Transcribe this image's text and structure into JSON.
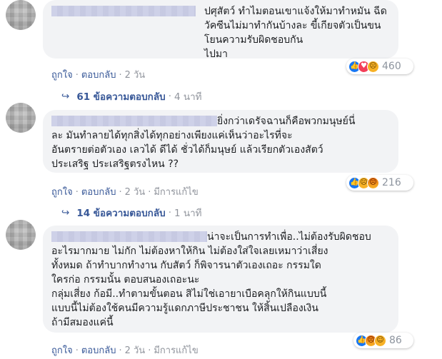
{
  "comments": [
    {
      "text": "ปศุสัตว์ ทำไมตอนเขาแจ้งให้มาทำหมัน ฉีด\nวัคซีนไม่มาทำกันบ้างละ ขี้เกียจตัวเป็นขน โยนความรับผิดชอบกัน\nไปมา",
      "reaction_count": "460",
      "reactions": [
        "like-icon",
        "love-icon",
        "sad-icon"
      ],
      "actions": {
        "like": "ถูกใจ",
        "reply": "ตอบกลับ",
        "time": "2 วัน"
      }
    },
    {
      "text": "ยิ่งกว่าเดรัจฉานก็คือพวกมนุษย์นี่\nละ มันทำลายได้ทุกสิ่งได้ทุกอย่างเพียงแค่เห็นว่าอะไรที่จะ\nอันตรายต่อตัวเอง เลวได้ ดีได้ ชั่วได้ก็มนุษย์ แล้วเรียกตัวเองสัตว์\nประเสริฐ ประเสริฐตรงไหน ??",
      "reaction_count": "216",
      "reactions": [
        "like-icon",
        "sad-icon",
        "angry-icon"
      ],
      "actions": {
        "like": "ถูกใจ",
        "reply": "ตอบกลับ",
        "time": "2 วัน",
        "edited": "มีการแก้ไข"
      }
    },
    {
      "text": "น่าจะเป็นการทำเพื่อ..ไม่ต้องรับผิดชอบ\nอะไรมากมาย ไม่กัก ไม่ต้องหาให้กิน ไม่ต้องใส่ใจเลยเหมาว่าเสี่ยง\nทั้งหมด ถ้าทำบากทำงาน กับสัตว์ ก็พิจารนาตัวเองเถอะ กรรมใด\nใครก่อ กรรมนั้น ตอบสนองเถอะนะ\nกลุ่มเสี่ยง ก้อมี..ทำตามขั้นตอน สิไม่ใช่เอายาเบือคลุกให้กินแบบนี้\nแบบนี้ไม่ต้องใช้คนมีความรู้แดกภาษีประชาชน ให้สิ้นเปลืองเงิน\nถ้ามีสมองแค่นี้",
      "reaction_count": "86",
      "reactions": [
        "like-icon",
        "angry-icon",
        "haha-icon"
      ],
      "actions": {
        "like": "ถูกใจ",
        "reply": "ตอบกลับ",
        "time": "2 วัน",
        "edited": "มีการแก้ไข"
      }
    }
  ],
  "reply_threads": [
    {
      "label": "61 ข้อความตอบกลับ",
      "time": "4 นาที"
    },
    {
      "label": "14 ข้อความตอบกลับ",
      "time": "1 นาที"
    }
  ],
  "colors": {
    "link": "#385898",
    "bubble": "#f2f3f5",
    "like": "#1877f2",
    "love": "#f33e58",
    "sad": "#f7b125"
  }
}
